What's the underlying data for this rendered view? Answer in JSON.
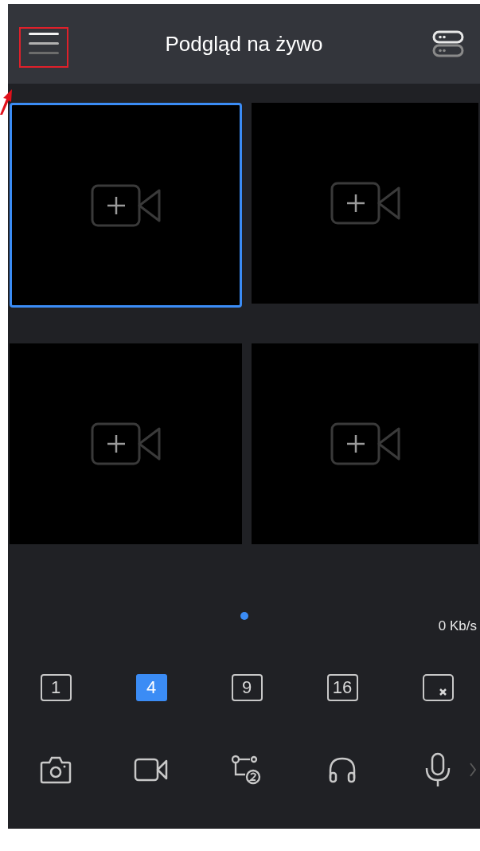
{
  "header": {
    "title": "Podgląd na żywo"
  },
  "tiles": [
    {
      "selected": true
    },
    {
      "selected": false
    },
    {
      "selected": false
    },
    {
      "selected": false
    }
  ],
  "page_dots": [
    {
      "selected": true
    }
  ],
  "bitrate": "0 Kb/s",
  "layouts": [
    {
      "label": "1",
      "selected": false
    },
    {
      "label": "4",
      "selected": true
    },
    {
      "label": "9",
      "selected": false
    },
    {
      "label": "16",
      "selected": false
    }
  ]
}
